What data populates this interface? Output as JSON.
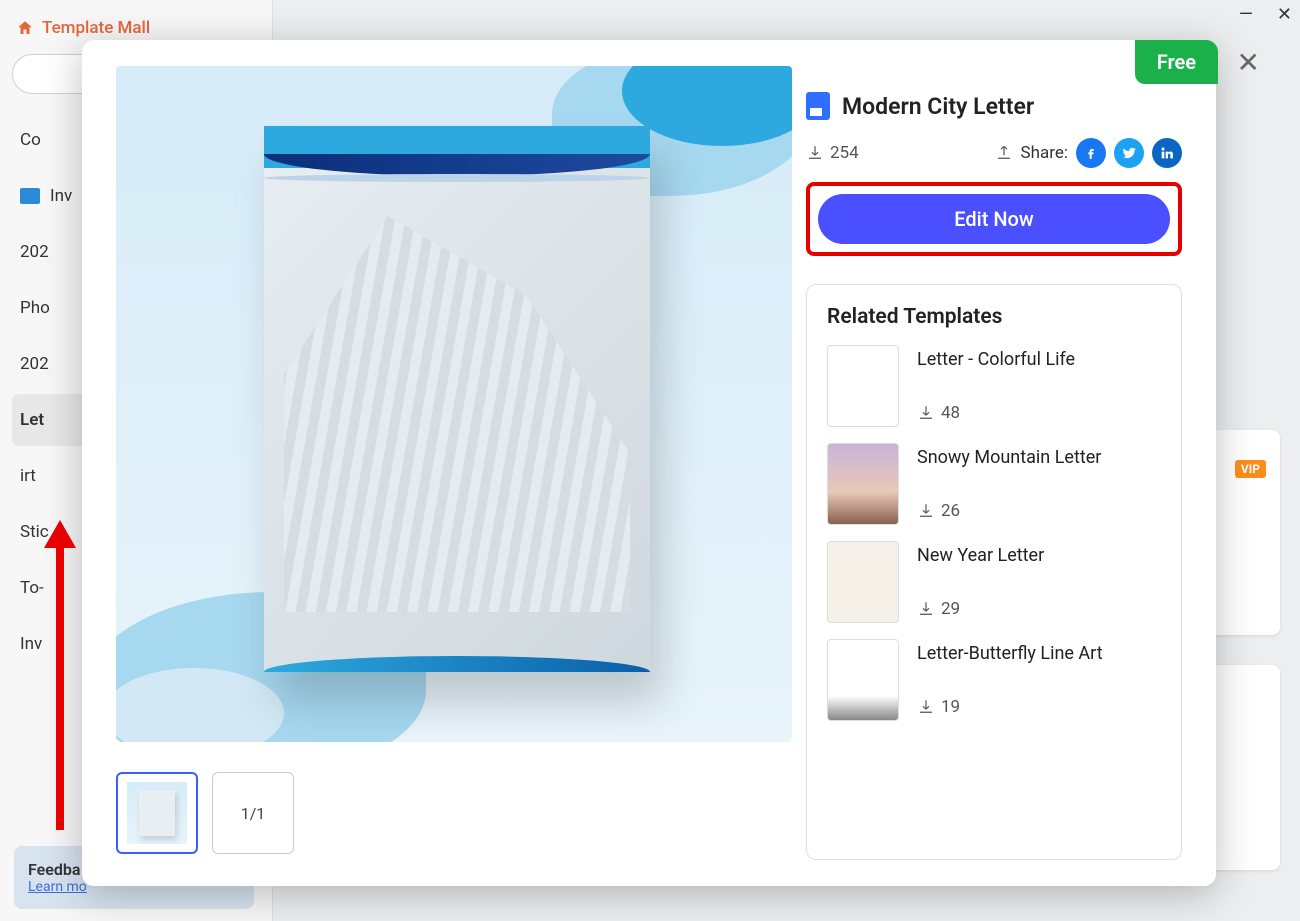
{
  "app": {
    "title": "Template Mall"
  },
  "window": {
    "minimize": "—",
    "close": "✕"
  },
  "sidebar": {
    "items": [
      {
        "label": "Co"
      },
      {
        "label": "Inv"
      },
      {
        "label": "202"
      },
      {
        "label": "Pho"
      },
      {
        "label": "202"
      },
      {
        "label": "Let"
      },
      {
        "label": "irt"
      },
      {
        "label": "Stic"
      },
      {
        "label": "To-"
      },
      {
        "label": "Inv"
      }
    ],
    "active_index": 5
  },
  "feedback": {
    "title": "Feedba",
    "link": "Learn mo"
  },
  "modal": {
    "free_badge": "Free",
    "close": "✕",
    "template": {
      "title": "Modern City Letter",
      "downloads": "254",
      "share_label": "Share:",
      "edit_button": "Edit Now"
    },
    "thumbs": {
      "page_indicator": "1/1"
    },
    "related": {
      "heading": "Related Templates",
      "items": [
        {
          "name": "Letter - Colorful Life",
          "downloads": "48"
        },
        {
          "name": "Snowy Mountain Letter",
          "downloads": "26"
        },
        {
          "name": "New Year Letter",
          "downloads": "29"
        },
        {
          "name": "Letter-Butterfly Line Art",
          "downloads": "19"
        }
      ]
    }
  },
  "bg": {
    "vip": "VIP"
  }
}
